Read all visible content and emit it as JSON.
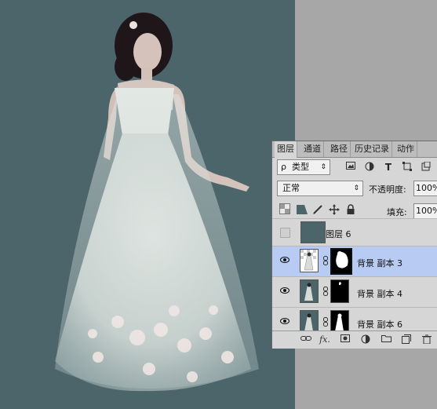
{
  "panel": {
    "tabs": [
      "图层",
      "通道",
      "路径",
      "历史记录",
      "动作"
    ],
    "filter": {
      "search_glyph": "ρ",
      "label": "类型",
      "arrow": "⇕"
    },
    "filter_icons": [
      "image-filter-icon",
      "adjustment-filter-icon",
      "T",
      "shape-filter-icon",
      "smart-object-filter-icon"
    ],
    "blend_mode": "正常",
    "opacity_label": "不透明度:",
    "opacity_value": "100%",
    "fill_label": "填充:",
    "fill_value": "100%",
    "layers": [
      {
        "name": "图层 6",
        "visible": false,
        "selected": false
      },
      {
        "name": "背景 副本 3",
        "visible": true,
        "selected": true
      },
      {
        "name": "背景 副本 4",
        "visible": true,
        "selected": false
      },
      {
        "name": "背景 副本 6",
        "visible": true,
        "selected": false
      }
    ],
    "footer_icons": [
      "link-icon",
      "fx",
      "mask-icon",
      "adjustment-icon",
      "folder-icon",
      "new-layer-icon",
      "trash-icon"
    ],
    "footer_fx": "fx."
  }
}
